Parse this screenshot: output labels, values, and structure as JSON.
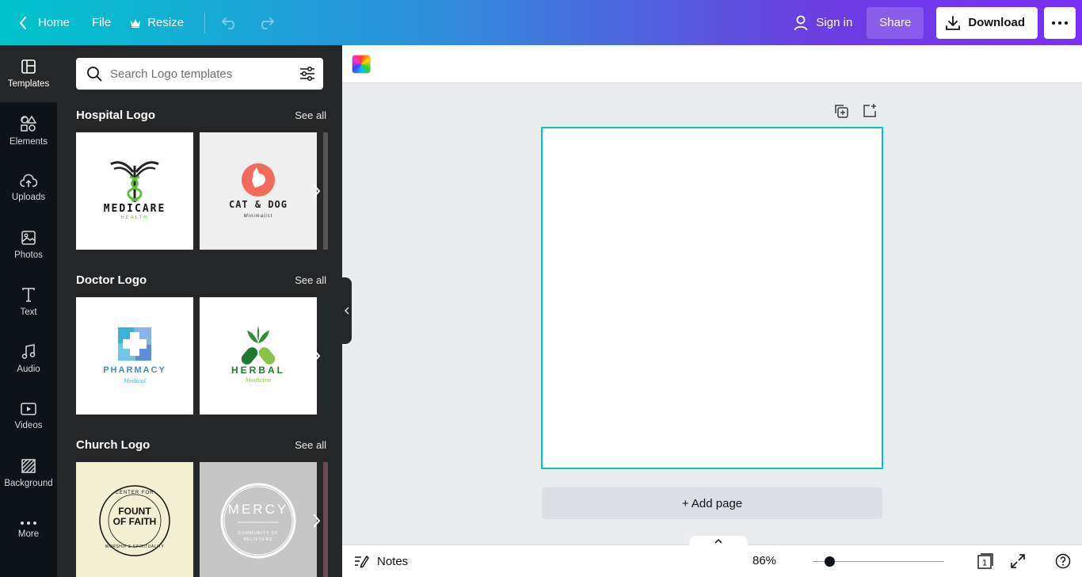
{
  "topbar": {
    "home": "Home",
    "file": "File",
    "resize": "Resize",
    "sign_in": "Sign in",
    "share": "Share",
    "download": "Download"
  },
  "rail": [
    {
      "label": "Templates",
      "icon": "templates-icon"
    },
    {
      "label": "Elements",
      "icon": "elements-icon"
    },
    {
      "label": "Uploads",
      "icon": "uploads-icon"
    },
    {
      "label": "Photos",
      "icon": "photos-icon"
    },
    {
      "label": "Text",
      "icon": "text-icon"
    },
    {
      "label": "Audio",
      "icon": "audio-icon"
    },
    {
      "label": "Videos",
      "icon": "videos-icon"
    },
    {
      "label": "Background",
      "icon": "background-icon"
    },
    {
      "label": "More",
      "icon": "more-icon"
    }
  ],
  "search": {
    "placeholder": "Search Logo templates"
  },
  "sections": [
    {
      "title": "Hospital Logo",
      "see_all": "See all",
      "thumbs": [
        {
          "name": "MEDICARE",
          "sub": "HEALTH",
          "bg": "#ffffff"
        },
        {
          "name": "CAT & DOG",
          "sub": "Minimalist",
          "bg": "#efefef"
        }
      ]
    },
    {
      "title": "Doctor Logo",
      "see_all": "See all",
      "thumbs": [
        {
          "name": "PHARMACY",
          "sub": "Medical",
          "bg": "#ffffff"
        },
        {
          "name": "HERBAL",
          "sub": "Medicine",
          "bg": "#ffffff"
        }
      ]
    },
    {
      "title": "Church Logo",
      "see_all": "See all",
      "thumbs": [
        {
          "name": "FOUNT OF FAITH",
          "ring_top": "CENTER FOR",
          "ring_bottom": "WORSHIP & SPIRITUALITY",
          "bg": "#f3efd3"
        },
        {
          "name": "MERCY",
          "sub": "COMMUNITY OF BELIEVERS",
          "bg": "#c6c6c6"
        }
      ]
    }
  ],
  "editor": {
    "add_page": "+ Add page",
    "notes": "Notes",
    "zoom": "86%",
    "zoom_fraction": 0.13,
    "page_count": "1"
  },
  "colors": {
    "accent": "#00c4cc",
    "panel": "#252627",
    "rail": "#0e1318"
  }
}
